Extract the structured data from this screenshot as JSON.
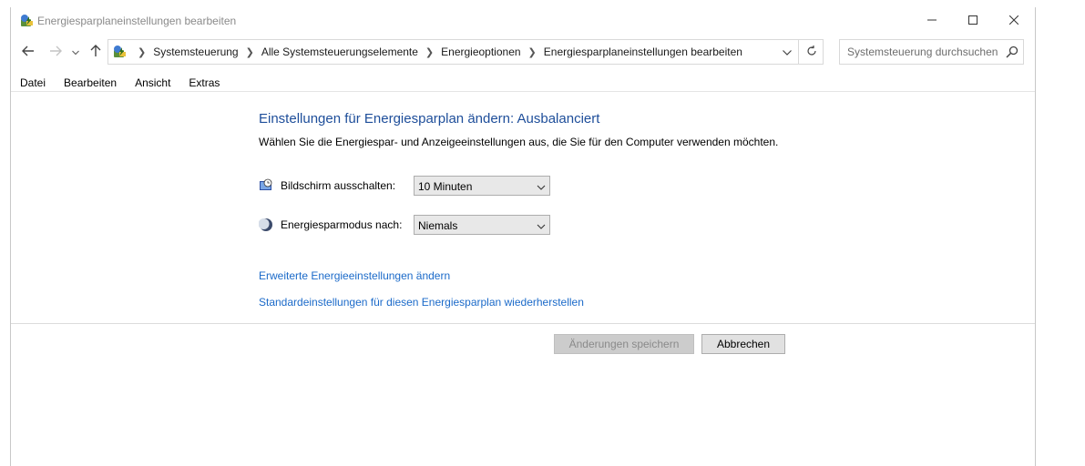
{
  "window": {
    "title": "Energiesparplaneinstellungen bearbeiten",
    "app_icon": "control-panel-power-icon",
    "controls": [
      "minimize-icon",
      "maximize-icon",
      "close-icon"
    ]
  },
  "nav": {
    "back_icon": "arrow-left-icon",
    "forward_icon": "arrow-right-icon",
    "recent_icon": "chevron-down-icon",
    "up_icon": "arrow-up-icon",
    "breadcrumb": [
      {
        "label": "Systemsteuerung"
      },
      {
        "label": "Alle Systemsteuerungselemente"
      },
      {
        "label": "Energieoptionen"
      },
      {
        "label": "Energiesparplaneinstellungen bearbeiten"
      }
    ],
    "refresh_icon": "refresh-icon",
    "search_placeholder": "Systemsteuerung durchsuchen",
    "search_icon": "search-icon"
  },
  "menu": {
    "items": [
      {
        "label": "Datei"
      },
      {
        "label": "Bearbeiten"
      },
      {
        "label": "Ansicht"
      },
      {
        "label": "Extras"
      }
    ]
  },
  "content": {
    "heading": "Einstellungen für Energiesparplan ändern: Ausbalanciert",
    "subheading": "Wählen Sie die Energiespar- und Anzeigeeinstellungen aus, die Sie für den Computer verwenden möchten.",
    "settings": [
      {
        "label": "Bildschirm ausschalten:",
        "value": "10 Minuten",
        "icon": "monitor-clock-icon"
      },
      {
        "label": "Energiesparmodus nach:",
        "value": "Niemals",
        "icon": "moon-icon"
      }
    ],
    "links": [
      {
        "label": "Erweiterte Energieeinstellungen ändern"
      },
      {
        "label": "Standardeinstellungen für diesen Energiesparplan wiederherstellen"
      }
    ],
    "buttons": {
      "save": "Änderungen speichern",
      "cancel": "Abbrechen"
    }
  },
  "colors": {
    "heading": "#1e4e9a",
    "link": "#1b6ac9",
    "title_text": "#8a8a8a"
  }
}
